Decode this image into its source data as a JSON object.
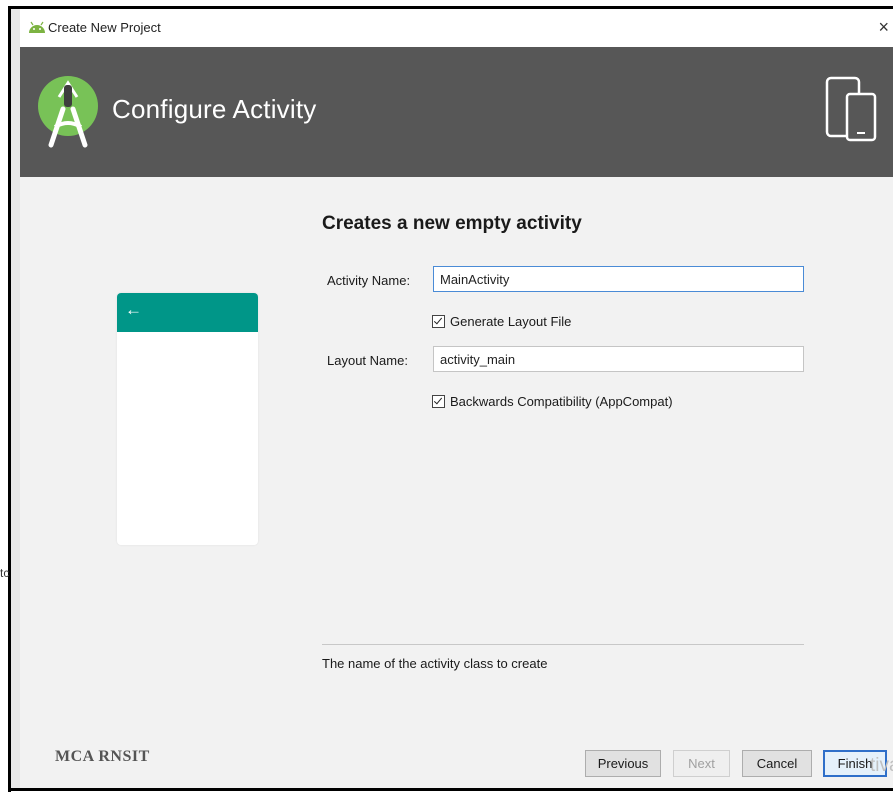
{
  "window": {
    "title": "Create New Project",
    "close_glyph": "×",
    "left_strip_char": "tc"
  },
  "header": {
    "title": "Configure Activity",
    "logo_icon": "android-studio-logo-icon",
    "device_icon": "phone-tablet-icon"
  },
  "preview": {
    "back_glyph": "←",
    "bar_color": "#009688"
  },
  "form": {
    "heading": "Creates a new empty activity",
    "activity_name_label": "Activity Name:",
    "activity_name_value": "MainActivity",
    "generate_layout_label": "Generate Layout File",
    "generate_layout_checked": true,
    "layout_name_label": "Layout Name:",
    "layout_name_value": "activity_main",
    "backwards_compat_label": "Backwards Compatibility (AppCompat)",
    "backwards_compat_checked": true,
    "hint": "The name of the activity class to create"
  },
  "watermark": "MCA RNSIT",
  "buttons": {
    "previous": "Previous",
    "next": "Next",
    "cancel": "Cancel",
    "finish": "Finish"
  },
  "overlay_text": "tiva",
  "colors": {
    "header_bg": "#575757",
    "content_bg": "#f2f2f2",
    "accent_teal": "#009688",
    "focus_blue": "#4a8bd6"
  }
}
